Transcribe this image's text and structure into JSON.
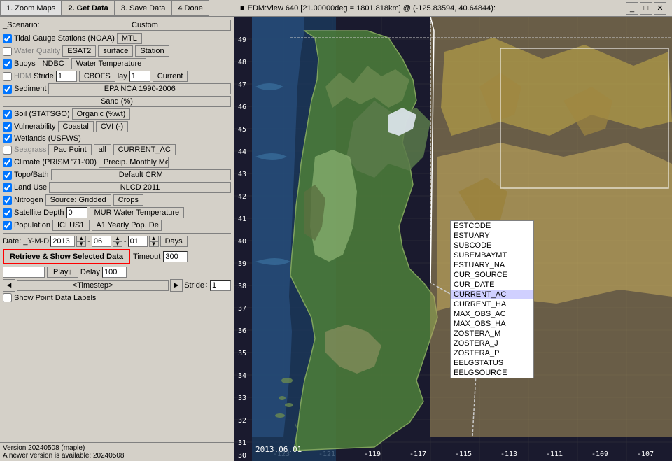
{
  "toolbar": {
    "btn1": "1. Zoom Maps",
    "btn2": "2. Get Data",
    "btn3": "3. Save Data",
    "btn4": "4 Done"
  },
  "scenario": {
    "label": "_Scenario:",
    "value": "Custom"
  },
  "map_title": "EDM:View 640 [21.00000deg = 1801.818km] @ (-125.83594, 40.64844):",
  "rows": [
    {
      "id": "tidal",
      "checkbox": true,
      "checked": true,
      "label": "Tidal Gauge Stations (NOAA)",
      "extra": "MTL"
    },
    {
      "id": "waterquality",
      "checkbox": true,
      "checked": false,
      "label": "Water Quality",
      "btns": [
        "ESAT2",
        "surface",
        "Station"
      ]
    },
    {
      "id": "buoys",
      "checkbox": true,
      "checked": true,
      "label": "Buoys",
      "btns": [
        "NDBC",
        "Water Temperature"
      ]
    },
    {
      "id": "hdm",
      "checkbox": true,
      "checked": false,
      "label": "HDM",
      "btns": [
        "Stride",
        "1",
        "CBOFS",
        "lay",
        "1",
        "Current"
      ]
    },
    {
      "id": "sediment",
      "checkbox": true,
      "checked": true,
      "label": "Sediment",
      "extra": "EPA NCA 1990-2006"
    },
    {
      "id": "sand",
      "label": "Sand (%)"
    },
    {
      "id": "soil",
      "checkbox": true,
      "checked": true,
      "label": "Soil (STATSGO)",
      "extra": "Organic (%wt)"
    },
    {
      "id": "vuln",
      "checkbox": true,
      "checked": true,
      "label": "Vulnerability",
      "btns": [
        "Coastal",
        "CVI (-)"
      ]
    },
    {
      "id": "wetlands",
      "checkbox": true,
      "checked": true,
      "label": "Wetlands (USFWS)"
    },
    {
      "id": "seagrass",
      "checkbox": true,
      "checked": false,
      "label": "Seagrass",
      "btns": [
        "Pac Point",
        "all",
        "CURRENT_AC"
      ]
    },
    {
      "id": "climate",
      "checkbox": true,
      "checked": true,
      "label": "Climate (PRISM '71-'00)",
      "extra": "Precip. Monthly Mea"
    },
    {
      "id": "topo",
      "checkbox": true,
      "checked": true,
      "label": "Topo/Bath",
      "extra": "Default CRM"
    },
    {
      "id": "landuse",
      "checkbox": true,
      "checked": true,
      "label": "Land Use",
      "extra": "NLCD 2011"
    },
    {
      "id": "nitrogen",
      "checkbox": true,
      "checked": true,
      "label": "Nitrogen",
      "btns": [
        "Source: Gridded",
        "Crops"
      ]
    },
    {
      "id": "satellite",
      "checkbox": true,
      "checked": true,
      "label": "Satellite",
      "btns": [
        "Depth",
        "0",
        "MUR Water Temperature"
      ]
    },
    {
      "id": "population",
      "checkbox": true,
      "checked": true,
      "label": "Population",
      "btns": [
        "ICLUS1",
        "A1 Yearly Pop. De"
      ]
    }
  ],
  "date": {
    "label": "Date: _Y-M-D",
    "year": "2013",
    "month": "06",
    "day": "01",
    "days_label": "Days"
  },
  "retrieve_btn": "Retrieve & Show Selected Data",
  "timeout": {
    "label": "Timeout",
    "value": "300"
  },
  "playback": {
    "play_label": "Play↓",
    "delay_label": "Delay",
    "delay_value": "100"
  },
  "timestep": {
    "prev_label": "◄",
    "label": "<Timestep>",
    "next_label": "►",
    "stride_label": "Stride÷",
    "stride_value": "1"
  },
  "show_labels": "Show Point Data Labels",
  "version": "Version 20240508 (maple)",
  "version2": "A newer version is available: 20240508",
  "dropdown_items": [
    "ESTCODE",
    "ESTUARY",
    "SUBCODE",
    "SUBEMBAYMT",
    "ESTUARY_NA",
    "CUR_SOURCE",
    "CUR_DATE",
    "CURRENT_AC",
    "CURRENT_HA",
    "MAX_OBS_AC",
    "MAX_OBS_HA",
    "ZOSTERA_M",
    "ZOSTERA_J",
    "ZOSTERA_P",
    "EELGSTATUS",
    "EELGSOURCE"
  ],
  "lat_labels": [
    "49",
    "48",
    "47",
    "46",
    "45",
    "44",
    "43",
    "42",
    "41",
    "40",
    "39",
    "38",
    "37",
    "36",
    "35",
    "34",
    "33",
    "32",
    "31",
    "30"
  ],
  "lon_labels": [
    "-123",
    "-121",
    "-119",
    "-117",
    "-115",
    "-113",
    "-111",
    "-109",
    "-107"
  ],
  "map_bottom_label": "2013.06.01"
}
